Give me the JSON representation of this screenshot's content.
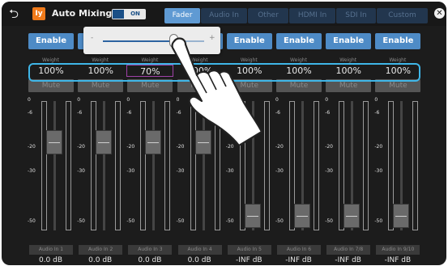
{
  "header": {
    "back_icon": "return-arrow-icon",
    "logo_text": "Iy",
    "title": "Auto Mixing",
    "toggle_label": "ON",
    "close_icon": "close-icon",
    "tabs": [
      {
        "label": "Fader",
        "active": true
      },
      {
        "label": "Audio In",
        "active": false
      },
      {
        "label": "Other",
        "active": false
      },
      {
        "label": "HDMI In",
        "active": false
      },
      {
        "label": "SDI In",
        "active": false
      },
      {
        "label": "Custom",
        "active": false
      }
    ]
  },
  "scale_labels": [
    "0",
    "-6",
    "-20",
    "-30",
    "-50"
  ],
  "channels": [
    {
      "enable": "Enable",
      "weight_label": "Weight",
      "weight": "100%",
      "mute": "Mute",
      "name": "Audio In 1",
      "level": "0.0 dB",
      "fader": 0.72,
      "selected": false
    },
    {
      "enable": "Enable",
      "weight_label": "Weight",
      "weight": "100%",
      "mute": "Mute",
      "name": "Audio In 2",
      "level": "0.0 dB",
      "fader": 0.72,
      "selected": false
    },
    {
      "enable": "Enable",
      "weight_label": "Weight",
      "weight": "70%",
      "mute": "Mute",
      "name": "Audio In 3",
      "level": "0.0 dB",
      "fader": 0.72,
      "selected": true
    },
    {
      "enable": "Enable",
      "weight_label": "Weight",
      "weight": "100%",
      "mute": "Mute",
      "name": "Audio In 4",
      "level": "0.0 dB",
      "fader": 0.72,
      "selected": false
    },
    {
      "enable": "Enable",
      "weight_label": "Weight",
      "weight": "100%",
      "mute": "Mute",
      "name": "Audio In 5",
      "level": "-INF dB",
      "fader": 0.02,
      "selected": false
    },
    {
      "enable": "Enable",
      "weight_label": "Weight",
      "weight": "100%",
      "mute": "Mute",
      "name": "Audio In 6",
      "level": "-INF dB",
      "fader": 0.02,
      "selected": false
    },
    {
      "enable": "Enable",
      "weight_label": "Weight",
      "weight": "100%",
      "mute": "Mute",
      "name": "Audio In 7/8",
      "level": "-INF dB",
      "fader": 0.02,
      "selected": false
    },
    {
      "enable": "Enable",
      "weight_label": "Weight",
      "weight": "100%",
      "mute": "Mute",
      "name": "Audio In 9/10",
      "level": "-INF dB",
      "fader": 0.02,
      "selected": false
    }
  ],
  "popup": {
    "minus": "-",
    "plus": "+",
    "value": 0.7
  },
  "colors": {
    "accent": "#5f9ad3",
    "enable": "#4e8bc6",
    "highlight": "#3fb6e8",
    "selected": "#a042a8",
    "logo": "#f07a1a"
  },
  "gesture_icon": "pointing-hand-icon"
}
